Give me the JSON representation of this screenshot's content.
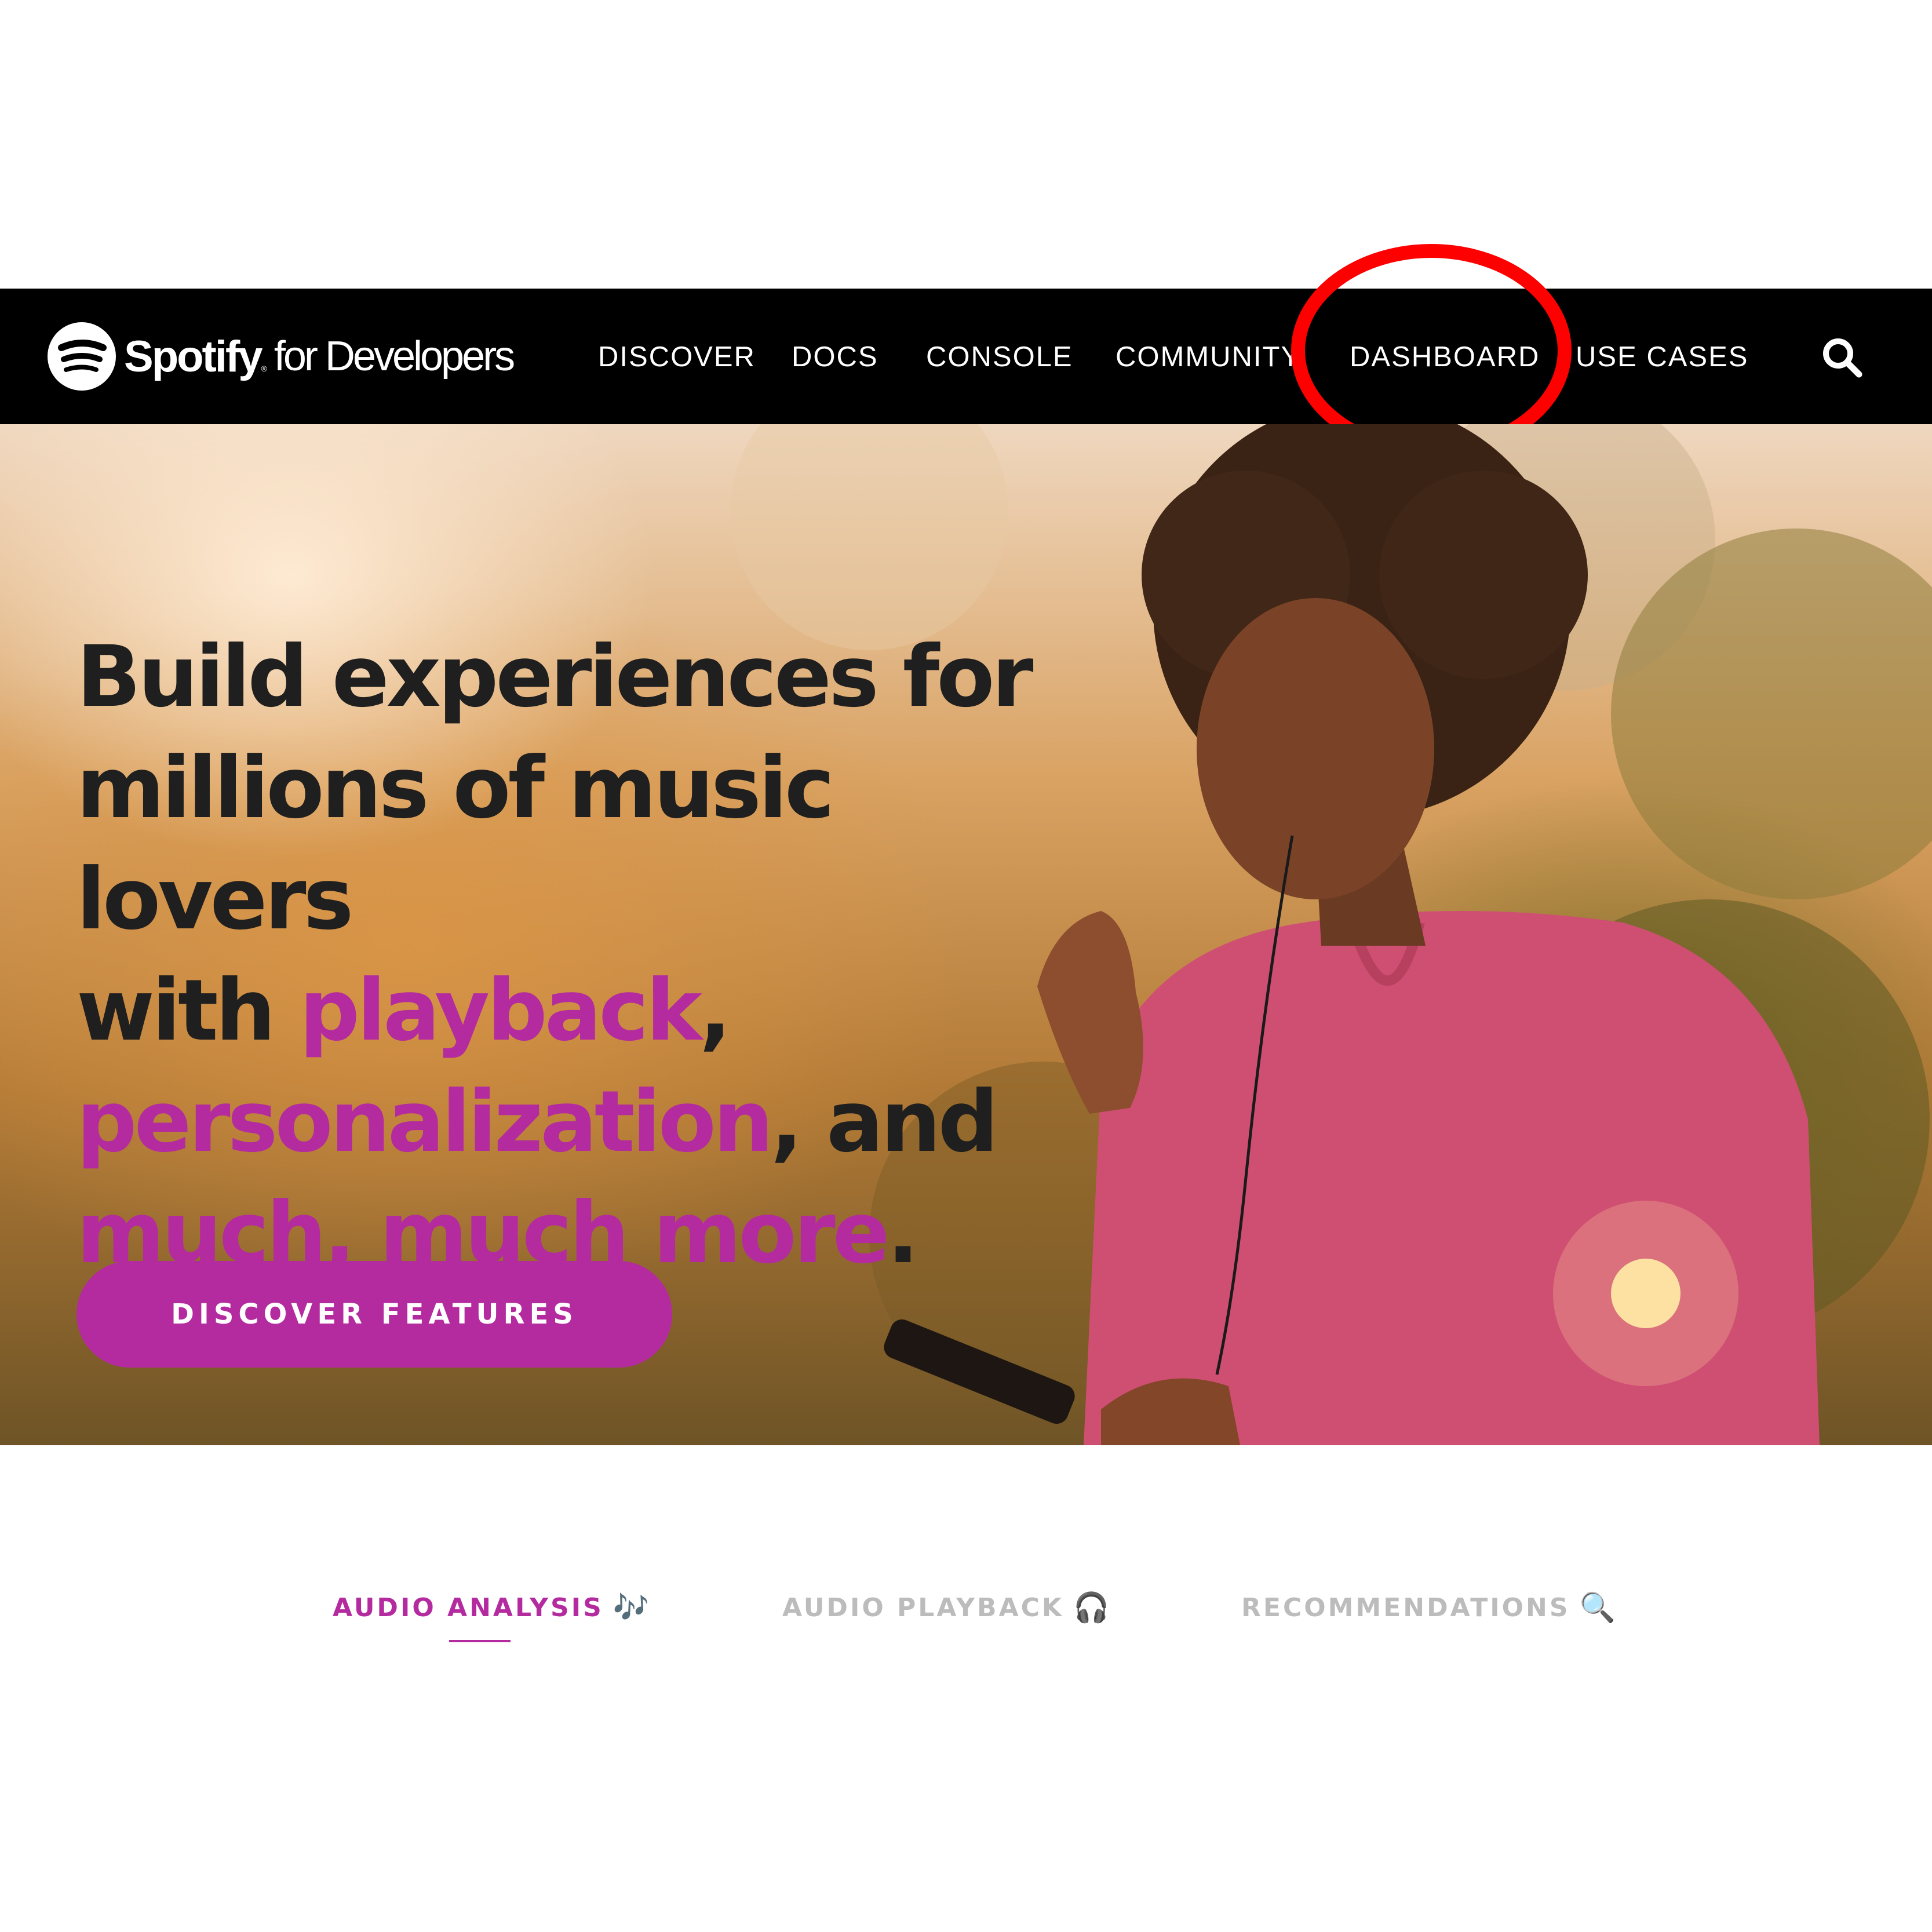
{
  "logo": {
    "brand": "Spotify",
    "trademark": "®",
    "suffix": "for Developers"
  },
  "nav": {
    "items": [
      {
        "label": "DISCOVER"
      },
      {
        "label": "DOCS"
      },
      {
        "label": "CONSOLE"
      },
      {
        "label": "COMMUNITY"
      },
      {
        "label": "DASHBOARD"
      },
      {
        "label": "USE CASES"
      }
    ],
    "highlighted_item": "DASHBOARD"
  },
  "hero": {
    "headline": {
      "line1": "Build experiences for",
      "line2": "millions of music lovers",
      "line3_prefix": "with ",
      "line3_accent": "playback",
      "line3_suffix": ",",
      "line4_accent": "personalization",
      "line4_suffix": ", and",
      "line5_accent": "much, much more",
      "line5_suffix": "."
    },
    "cta_label": "DISCOVER FEATURES"
  },
  "tabs": [
    {
      "label": "AUDIO ANALYSIS",
      "glyph": "🎶",
      "active": true
    },
    {
      "label": "AUDIO PLAYBACK",
      "glyph": "🎧",
      "active": false
    },
    {
      "label": "RECOMMENDATIONS",
      "glyph": "🔍",
      "active": false
    }
  ],
  "colors": {
    "nav_background": "#000000",
    "accent": "#b42b9f",
    "annotation": "#ff0000",
    "inactive_tab": "#bcbcbc"
  }
}
